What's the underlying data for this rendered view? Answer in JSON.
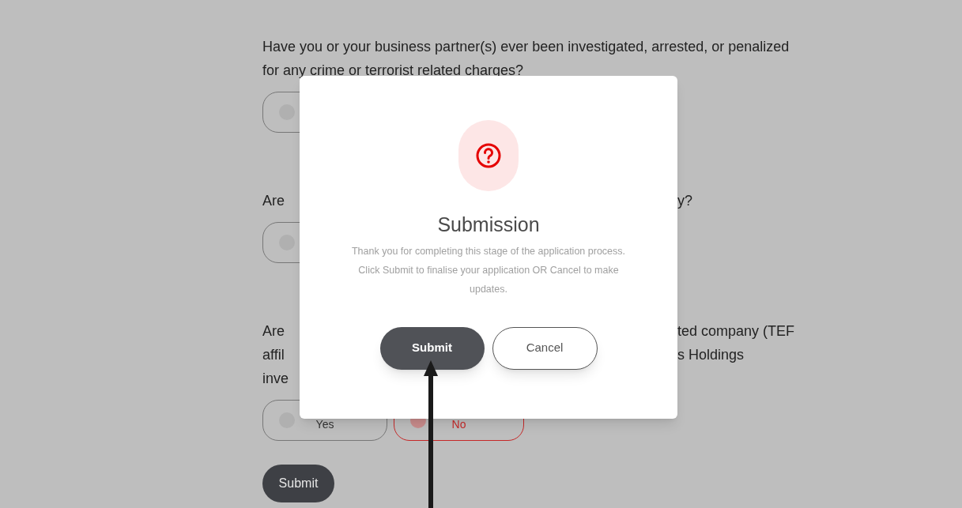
{
  "form": {
    "questions": [
      {
        "rows": [
          {
            "left": "Have you or your business partner(s) ever been investigated, arrested, or penalized"
          },
          {
            "left": "for any crime or terrorist related charges?"
          }
        ],
        "options": [
          {
            "selected": false
          }
        ]
      },
      {
        "rows": [
          {
            "left": "Are",
            "right": "y?"
          }
        ],
        "options": [
          {
            "selected": false
          }
        ]
      },
      {
        "rows": [
          {
            "left": "Are",
            "right": "ted company (TEF"
          },
          {
            "left": "affil",
            "right": "s Holdings"
          },
          {
            "left": "inve"
          }
        ],
        "options": [
          {
            "label": "Yes",
            "selected": false
          },
          {
            "label": "No",
            "selected": true
          }
        ]
      }
    ],
    "submit_button": "Submit"
  },
  "modal": {
    "title": "Submission",
    "message_lines": [
      "Thank you for completing this stage of the application process.",
      "Click Submit to finalise your application OR Cancel to make",
      "updates."
    ],
    "buttons": [
      {
        "label": "Submit",
        "kind": "primary"
      },
      {
        "label": "Cancel",
        "kind": "secondary"
      }
    ]
  }
}
